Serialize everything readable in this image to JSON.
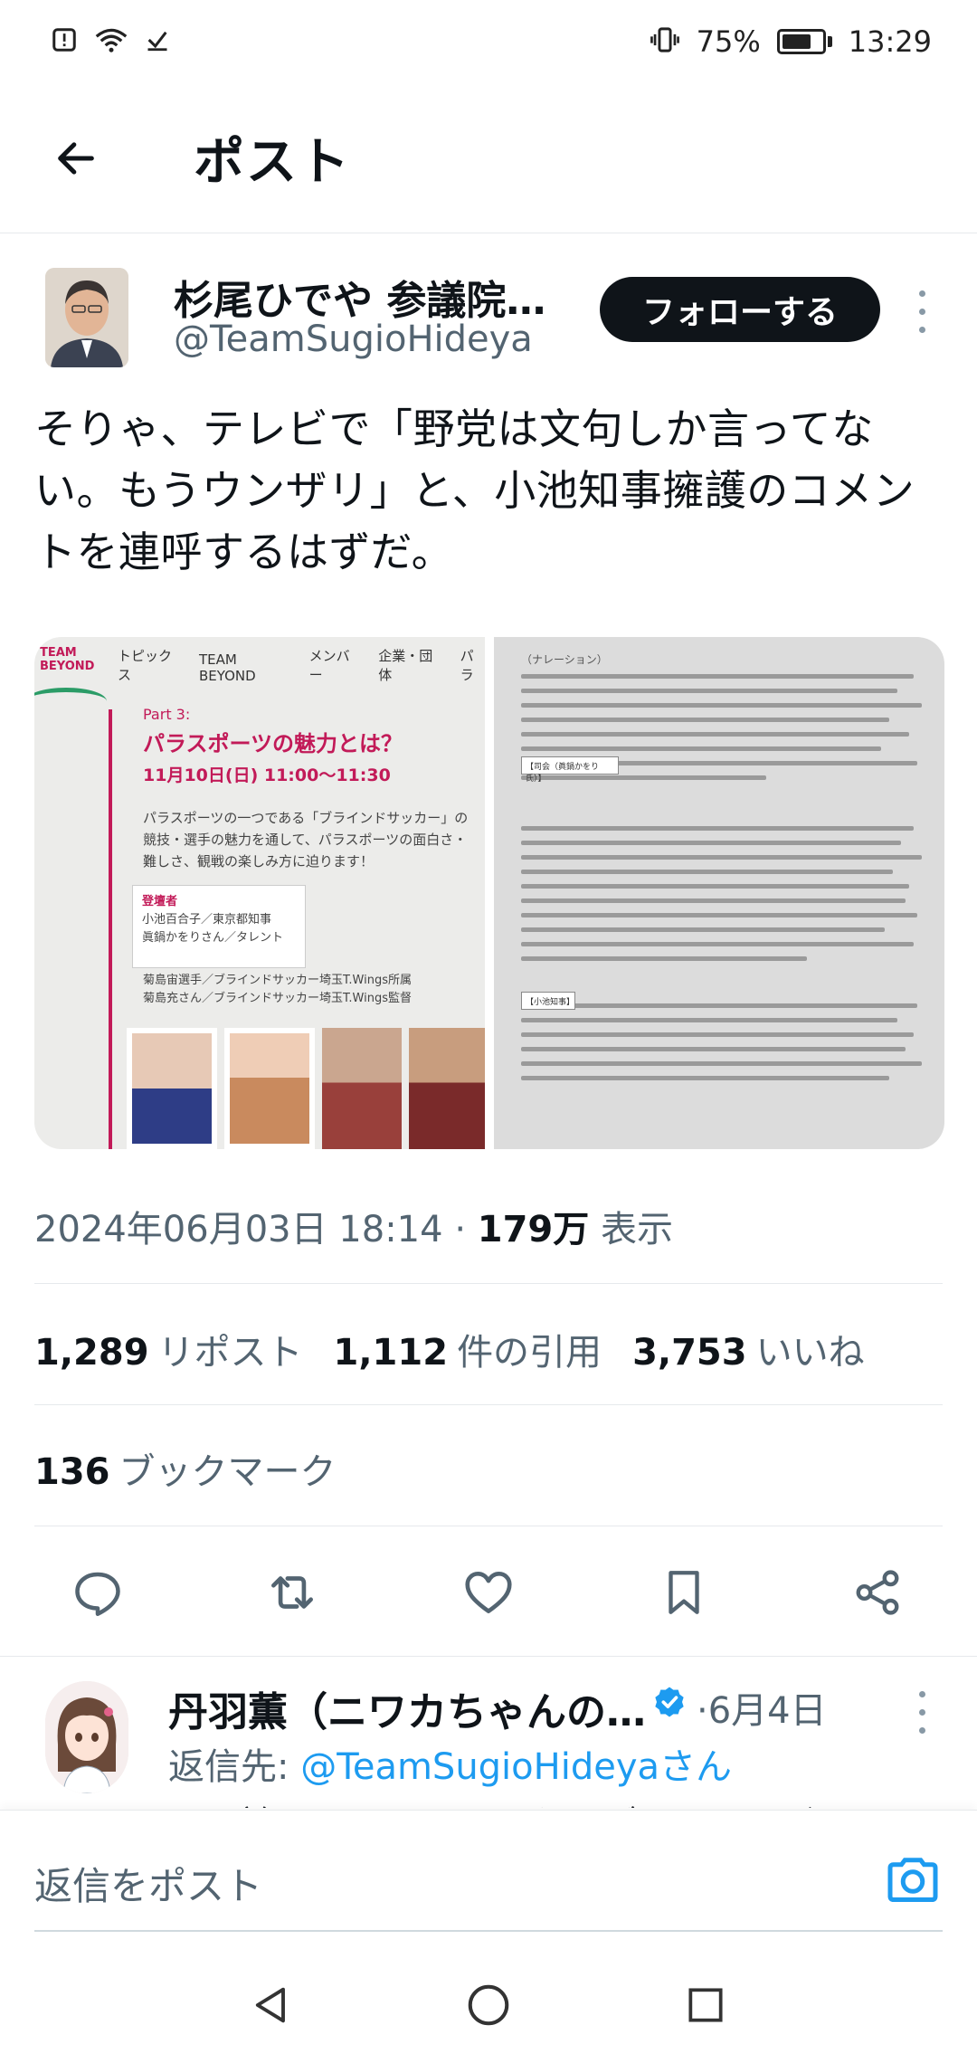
{
  "status_bar": {
    "battery_percent": "75%",
    "time": "13:29",
    "icons": [
      "alert-icon",
      "wifi-icon",
      "download-done-icon",
      "vibrate-icon",
      "battery-icon"
    ]
  },
  "header": {
    "title": "ポスト",
    "back_icon": "arrow-left-icon"
  },
  "post": {
    "author_name": "杉尾ひでや 参議院…",
    "author_handle": "@TeamSugioHideya",
    "follow_label": "フォローする",
    "text": "そりゃ、テレビで「野党は文句しか言ってない。もうウンザリ」と、小池知事擁護のコメントを連呼するはずだ。",
    "media": {
      "left": {
        "logo": "TEAM BEYOND",
        "nav": [
          "トピックス",
          "TEAM BEYOND",
          "メンバー",
          "企業・団体",
          "パラ"
        ],
        "part": "Part 3:",
        "title": "パラスポーツの魅力とは？",
        "date": "11月10日(日) 11:00〜11:30",
        "description": "パラスポーツの一つである「ブラインドサッカー」の競技・選手の魅力を通して、パラスポーツの面白さ・難しさ、観戦の楽しみ方に迫ります！",
        "cast_label": "登壇者",
        "cast": [
          "小池百合子／東京都知事",
          "眞鍋かをりさん／タレント",
          "菊島宙選手／ブラインドサッカー埼玉T.Wings所属",
          "菊島充さん／ブラインドサッカー埼玉T.Wings監督"
        ]
      },
      "right": {
        "heading": "（ナレーション）",
        "tag_1": "【司会（眞鍋かをり氏）】",
        "tag_2": "【小池知事】"
      }
    },
    "timestamp": "2024年06月03日 18:14",
    "separator": "·",
    "views_count": "179万",
    "views_label": "表示",
    "reposts_count": "1,289",
    "reposts_label": "リポスト",
    "quotes_count": "1,112",
    "quotes_label": "件の引用",
    "likes_count": "3,753",
    "likes_label": "いいね",
    "bookmarks_count": "136",
    "bookmarks_label": "ブックマーク"
  },
  "actions": [
    "reply-icon",
    "repost-icon",
    "like-icon",
    "bookmark-icon",
    "share-icon"
  ],
  "reply": {
    "author_name": "丹羽薫（ニワカちゃんの…",
    "separator": "·",
    "date": "6月4日",
    "reply_to_label": "返信先: ",
    "reply_to_handle": "@TeamSugioHideyaさん",
    "cut_text": "その論理でいうと、あなたがよくテレビで"
  },
  "compose": {
    "placeholder": "返信をポスト"
  },
  "colors": {
    "accent": "#1d9bf0",
    "text": "#0f1419",
    "secondary": "#536471",
    "brand_pink": "#c21a58"
  }
}
